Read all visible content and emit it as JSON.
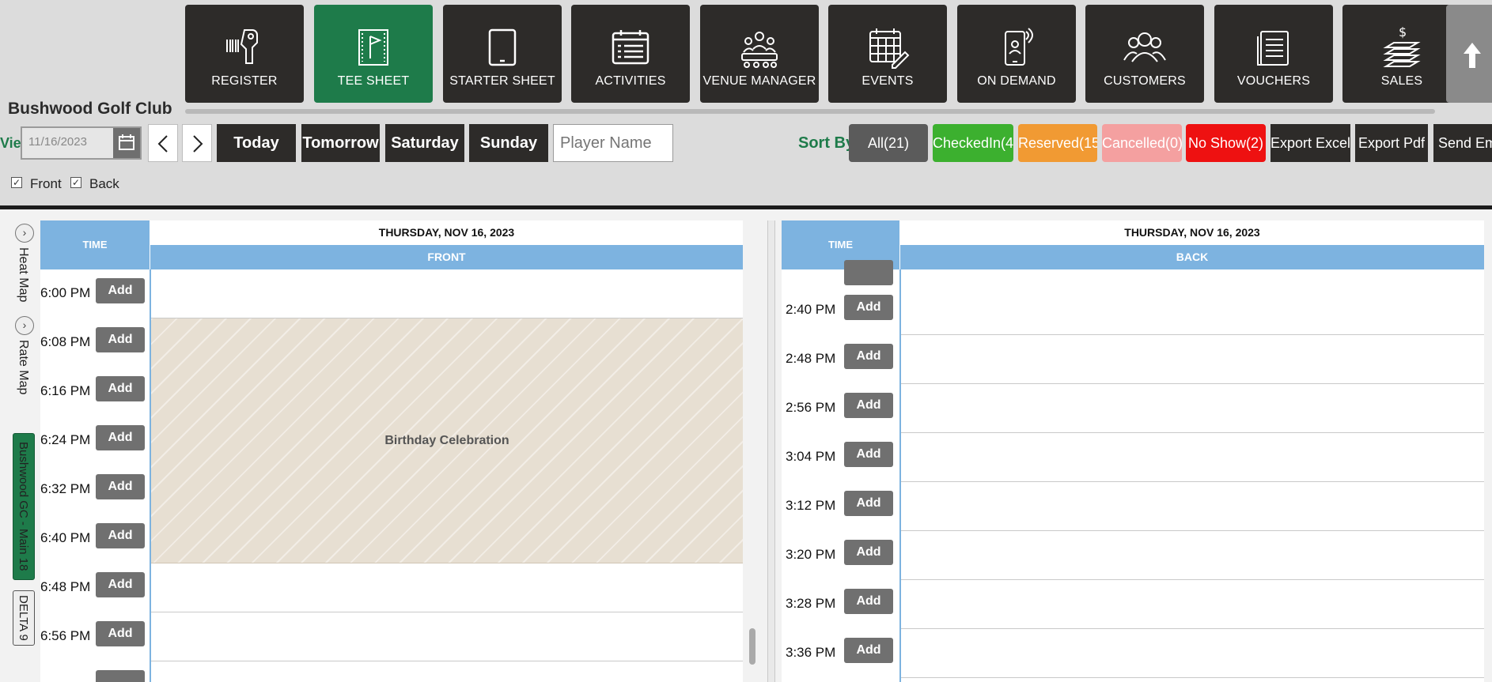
{
  "nav": {
    "tiles": [
      {
        "label": "REGISTER",
        "icon": "barcode-scanner-icon"
      },
      {
        "label": "TEE SHEET",
        "icon": "flag-sheet-icon",
        "active": true
      },
      {
        "label": "STARTER SHEET",
        "icon": "tablet-icon"
      },
      {
        "label": "ACTIVITIES",
        "icon": "calendar-list-icon"
      },
      {
        "label": "VENUE MANAGER",
        "icon": "meeting-icon"
      },
      {
        "label": "EVENTS",
        "icon": "calendar-edit-icon"
      },
      {
        "label": "ON DEMAND",
        "icon": "mobile-user-icon"
      },
      {
        "label": "CUSTOMERS",
        "icon": "users-icon"
      },
      {
        "label": "VOUCHERS",
        "icon": "voucher-icon"
      },
      {
        "label": "SALES",
        "icon": "cash-icon"
      }
    ],
    "scroll_up_icon": "arrow-up-icon"
  },
  "club_name": "Bushwood Golf Club",
  "toolbar": {
    "view_label": "Vie",
    "date_value": "11/16/2023",
    "day_buttons": [
      "Today",
      "Tomorrow",
      "Saturday",
      "Sunday"
    ],
    "player_placeholder": "Player Name",
    "sort_by": "Sort By",
    "sort_buttons": [
      {
        "label": "All(21)",
        "color": "#5b5b5b"
      },
      {
        "label": "CheckedIn(4",
        "color": "#3cb02f"
      },
      {
        "label": "Reserved(15",
        "color": "#f19a33"
      },
      {
        "label": "Cancelled(0)",
        "color": "#f4a0a0"
      },
      {
        "label": "No Show(2)",
        "color": "#ee1111"
      }
    ],
    "export_buttons": [
      "Export Excel",
      "Export Pdf",
      "Send Em"
    ],
    "checkboxes": [
      {
        "label": "Front",
        "checked": true
      },
      {
        "label": "Back",
        "checked": true
      }
    ]
  },
  "side_tabs": {
    "heat_map": "Heat Map",
    "rate_map": "Rate Map",
    "course_main": "Bushwood GC - Main 18",
    "course_delta": "DELTA 9"
  },
  "front": {
    "time_header": "TIME",
    "date_header": "THURSDAY, NOV 16, 2023",
    "section": "FRONT",
    "add_label": "Add",
    "times": [
      "6:00 PM",
      "6:08 PM",
      "6:16 PM",
      "6:24 PM",
      "6:32 PM",
      "6:40 PM",
      "6:48 PM",
      "6:56 PM"
    ],
    "event_label": "Birthday Celebration"
  },
  "back": {
    "time_header": "TIME",
    "date_header": "THURSDAY, NOV 16, 2023",
    "section": "BACK",
    "add_label": "Add",
    "times": [
      "2:40 PM",
      "2:48 PM",
      "2:56 PM",
      "3:04 PM",
      "3:12 PM",
      "3:20 PM",
      "3:28 PM",
      "3:36 PM"
    ]
  }
}
